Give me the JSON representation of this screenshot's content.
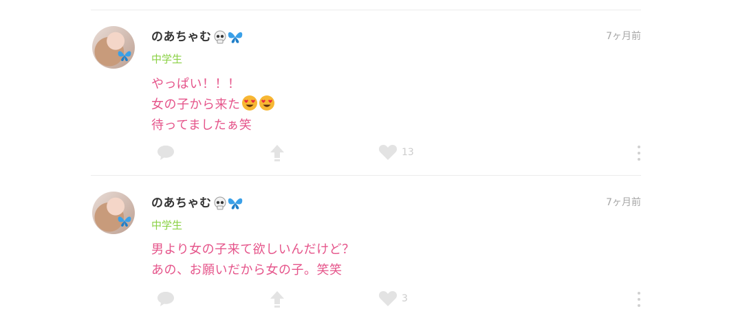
{
  "posts": [
    {
      "author": "のあちゃむ",
      "grade": "中学生",
      "time": "7ヶ月前",
      "lines": [
        "やっぱい！！！",
        "女の子から来た",
        "待ってましたぁ笑"
      ],
      "likes": "13"
    },
    {
      "author": "のあちゃむ",
      "grade": "中学生",
      "time": "7ヶ月前",
      "lines": [
        "男より女の子来て欲しいんだけど？",
        "あの、お願いだから女の子。笑笑"
      ],
      "likes": "3"
    }
  ],
  "icons": {
    "name_emoji": [
      "skull-icon",
      "butterfly-icon"
    ],
    "heart_eyes": "heart-eyes-emoji-icon",
    "comment": "comment-icon",
    "repost": "arrow-up-icon",
    "like": "heart-icon",
    "more": "more-vertical-icon"
  },
  "colors": {
    "name": "#333333",
    "grade": "#8bd145",
    "body": "#e5548a",
    "time": "#a6a6a6",
    "action_icon": "#e3e3e3"
  }
}
